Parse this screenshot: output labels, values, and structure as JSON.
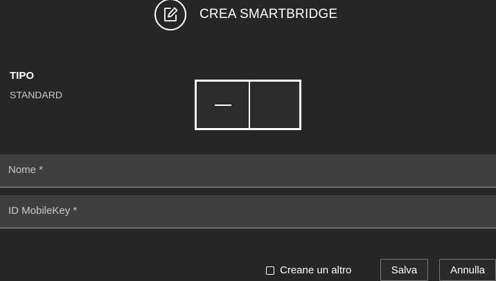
{
  "header": {
    "icon": "edit-icon",
    "title": "CREA SMARTBRIDGE"
  },
  "tipo": {
    "label": "TIPO",
    "value": "STANDARD"
  },
  "device": {
    "icon": "smartbridge-device-icon"
  },
  "form": {
    "nome_placeholder": "Nome *",
    "mobilekey_placeholder": "ID MobileKey *"
  },
  "footer": {
    "create_another_label": "Creane un altro",
    "create_another_checked": false,
    "save_label": "Salva",
    "cancel_label": "Annulla"
  }
}
